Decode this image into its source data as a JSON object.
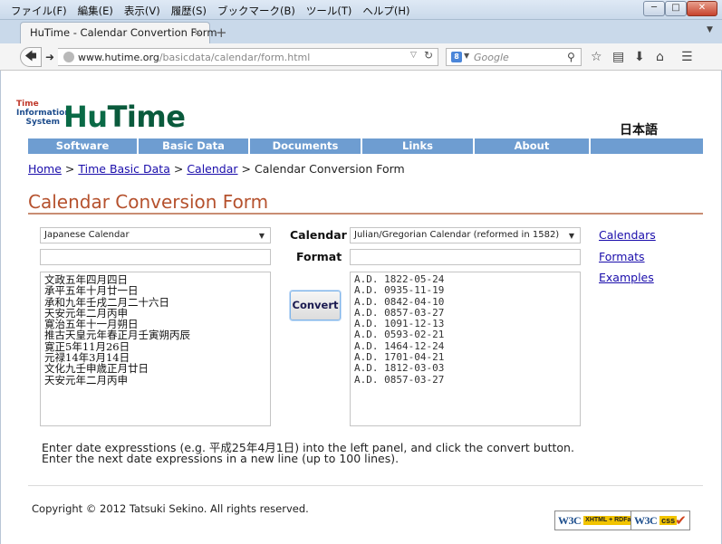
{
  "browser": {
    "menu": [
      "ファイル(F)",
      "編集(E)",
      "表示(V)",
      "履歴(S)",
      "ブックマーク(B)",
      "ツール(T)",
      "ヘルプ(H)"
    ],
    "tab_title": "HuTime - Calendar Convertion Form",
    "tab_close": "×",
    "tab_new": "+",
    "url_host": "www.hutime.org",
    "url_path": "/basicdata/calendar/form.html",
    "search_placeholder": "Google",
    "icons": [
      "back-icon",
      "forward-icon",
      "reload-icon",
      "bookmark-star-icon",
      "reading-list-icon",
      "download-icon",
      "home-icon",
      "menu-icon"
    ]
  },
  "site": {
    "logo_line1": "Time",
    "logo_line2": "Information",
    "logo_line3": "System",
    "logo_hu": "Hu",
    "logo_time": "Time",
    "lang_link": "日本語",
    "nav": [
      "Software",
      "Basic Data",
      "Documents",
      "Links",
      "About",
      ""
    ]
  },
  "breadcrumb": {
    "home": "Home",
    "sep": ">",
    "basic_data": "Time Basic Data",
    "calendar": "Calendar",
    "current": "Calendar Conversion Form"
  },
  "form": {
    "title": "Calendar Conversion Form",
    "source_calendar": "Japanese Calendar",
    "calendar_label": "Calendar",
    "target_calendar": "Julian/Gregorian Calendar (reformed in 1582)",
    "format_label": "Format",
    "convert_label": "Convert",
    "input_lines": [
      "文政五年四月四日",
      "承平五年十月廿一日",
      "承和九年壬戌二月二十六日",
      "天安元年二月丙申",
      "寛治五年十一月朔日",
      "推古天皇元年春正月壬寅朔丙辰",
      "寛正5年11月26日",
      "元禄14年3月14日",
      "文化九壬申歳正月廿日",
      "天安元年二月丙申"
    ],
    "output_lines": [
      "A.D. 1822-05-24",
      "A.D. 0935-11-19",
      "A.D. 0842-04-10",
      "A.D. 0857-03-27",
      "A.D. 1091-12-13",
      "A.D. 0593-02-21",
      "A.D. 1464-12-24",
      "A.D. 1701-04-21",
      "A.D. 1812-03-03",
      "A.D. 0857-03-27"
    ],
    "side_links": [
      "Calendars",
      "Formats",
      "Examples"
    ],
    "instruction1": "Enter date expresstions (e.g. 平成25年4月1日) into the left panel, and click the convert button.",
    "instruction2": "Enter the next date expressions in a new line (up to 100 lines)."
  },
  "footer": {
    "copyright": "Copyright © 2012 Tatsuki Sekino. All rights reserved.",
    "badge1_w3c": "W3C",
    "badge1_tag": "XHTML + RDFa",
    "badge2_w3c": "W3C",
    "badge2_tag": "css"
  }
}
